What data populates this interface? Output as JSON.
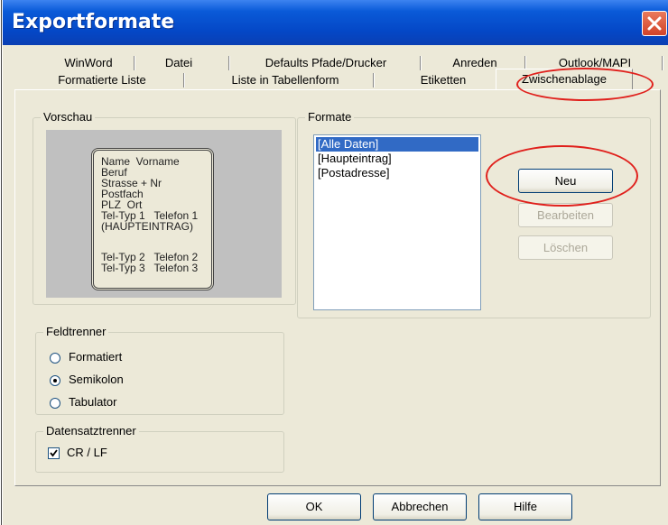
{
  "window": {
    "title": "Exportformate"
  },
  "tabs_back": [
    "WinWord",
    "Datei",
    "Defaults Pfade/Drucker",
    "Anreden",
    "Outlook/MAPI"
  ],
  "tabs_front": [
    "Formatierte Liste",
    "Liste in Tabellenform",
    "Etiketten",
    "Zwischenablage"
  ],
  "active_tab": "Zwischenablage",
  "preview": {
    "label": "Vorschau",
    "lines": [
      "Name  Vorname",
      "Beruf",
      "Strasse + Nr",
      "Postfach",
      "PLZ  Ort",
      "Tel-Typ 1   Telefon 1",
      "(HAUPTEINTRAG)",
      "",
      "Tel-Typ 2   Telefon 2",
      "Tel-Typ 3   Telefon 3"
    ]
  },
  "formats": {
    "label": "Formate",
    "items": [
      "[Alle Daten]",
      "[Haupteintrag]",
      "[Postadresse]"
    ],
    "selected": 0
  },
  "buttons": {
    "new": "Neu",
    "edit": "Bearbeiten",
    "delete": "Löschen",
    "ok": "OK",
    "cancel": "Abbrechen",
    "help": "Hilfe"
  },
  "field_separator": {
    "label": "Feldtrenner",
    "options": [
      "Formatiert",
      "Semikolon",
      "Tabulator"
    ],
    "selected": "Semikolon"
  },
  "record_separator": {
    "label": "Datensatztrenner",
    "option": "CR / LF",
    "checked": true
  },
  "colors": {
    "titlebar": "#0447c6",
    "highlight": "#316ac5",
    "annotation": "#e0201c",
    "dialog_bg": "#ece9d8"
  }
}
